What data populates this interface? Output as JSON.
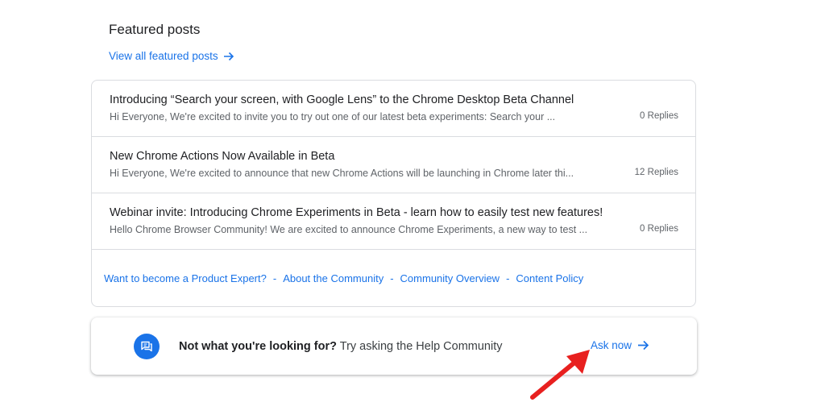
{
  "featured": {
    "title": "Featured posts",
    "view_all_label": "View all featured posts"
  },
  "posts": [
    {
      "title": "Introducing “Search your screen, with Google Lens” to the Chrome Desktop Beta Channel",
      "snippet": "Hi Everyone, We're excited to invite you to try out one of our latest beta experiments: Search your ...",
      "replies": "0 Replies"
    },
    {
      "title": "New Chrome Actions Now Available in Beta",
      "snippet": "Hi Everyone, We're excited to announce that new Chrome Actions will be launching in Chrome later thi...",
      "replies": "12 Replies"
    },
    {
      "title": "Webinar invite: Introducing Chrome Experiments in Beta - learn how to easily test new features!",
      "snippet": "Hello Chrome Browser Community! We are excited to announce Chrome Experiments, a new way to test ...",
      "replies": "0 Replies"
    }
  ],
  "footer_links": {
    "product_expert": "Want to become a Product Expert?",
    "about": "About the Community",
    "overview": "Community Overview",
    "policy": "Content Policy",
    "separator": "-"
  },
  "ask": {
    "bold_text": "Not what you're looking for?",
    "text": " Try asking the Help Community",
    "button_label": "Ask now",
    "icon": "chat-bubbles-icon"
  },
  "colors": {
    "link": "#1a73e8",
    "text": "#202124",
    "muted": "#5f6368",
    "border": "#dadce0",
    "annotation": "#e8201f"
  }
}
